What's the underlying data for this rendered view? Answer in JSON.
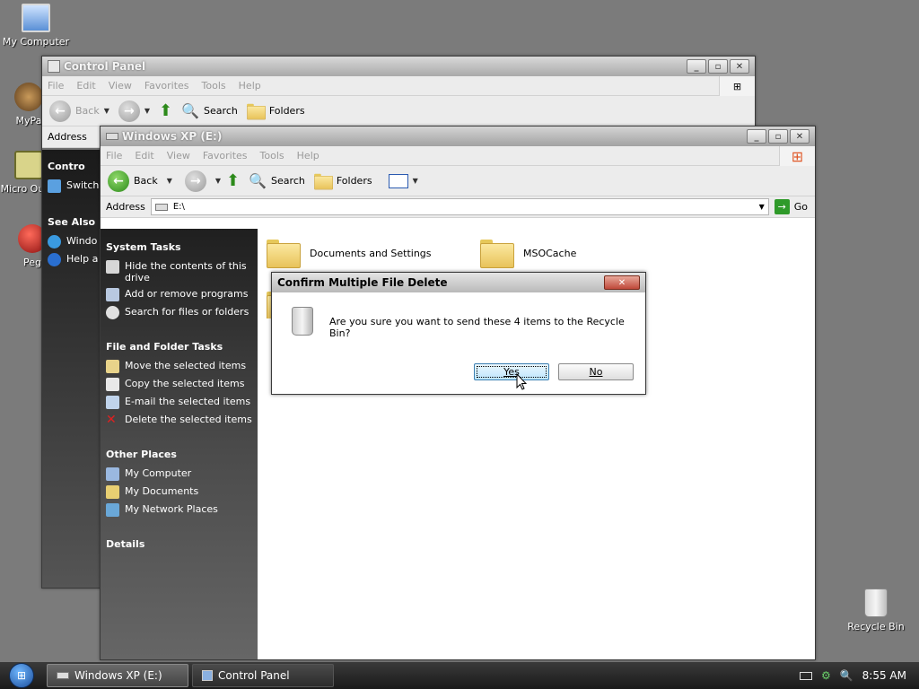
{
  "desktop": {
    "icons": [
      {
        "label": "My Computer",
        "icon": "my-computer-icon"
      },
      {
        "label": "MyPa",
        "icon": "mypa-shortcut-icon"
      },
      {
        "label": "Micro Outlo",
        "icon": "outlook-shortcut-icon"
      },
      {
        "label": "Peg",
        "icon": "peg-icon"
      },
      {
        "label": "Recycle Bin",
        "icon": "recycle-bin-icon"
      }
    ]
  },
  "control_panel": {
    "title": "Control Panel",
    "menu": [
      "File",
      "Edit",
      "View",
      "Favorites",
      "Tools",
      "Help"
    ],
    "back_label": "Back",
    "search_label": "Search",
    "folders_label": "Folders",
    "address_label": "Address",
    "side_title": "Contro",
    "side_switch": "Switch",
    "see_also": "See Also",
    "see_also_items": [
      "Windo",
      "Help a"
    ]
  },
  "explorer": {
    "title": "Windows XP (E:)",
    "menu": [
      "File",
      "Edit",
      "View",
      "Favorites",
      "Tools",
      "Help"
    ],
    "toolbar": {
      "back": "Back",
      "search": "Search",
      "folders": "Folders"
    },
    "address": {
      "label": "Address",
      "value": "E:\\",
      "go": "Go"
    },
    "system_tasks": {
      "heading": "System Tasks",
      "items": [
        "Hide the contents of this drive",
        "Add or remove programs",
        "Search for files or folders"
      ]
    },
    "file_tasks": {
      "heading": "File and Folder Tasks",
      "items": [
        "Move the selected items",
        "Copy the selected items",
        "E-mail the selected items",
        "Delete the selected items"
      ]
    },
    "other_places": {
      "heading": "Other Places",
      "items": [
        "My Computer",
        "My Documents",
        "My Network Places"
      ]
    },
    "details_heading": "Details",
    "files": [
      {
        "name": "Documents and Settings"
      },
      {
        "name": "MSOCache"
      }
    ]
  },
  "dialog": {
    "title": "Confirm Multiple File Delete",
    "message": "Are you sure you want to send these 4 items to the Recycle Bin?",
    "yes": "Yes",
    "no": "No"
  },
  "taskbar": {
    "tasks": [
      {
        "label": "Windows XP (E:)",
        "active": true
      },
      {
        "label": "Control Panel",
        "active": false
      }
    ],
    "clock": "8:55 AM"
  }
}
